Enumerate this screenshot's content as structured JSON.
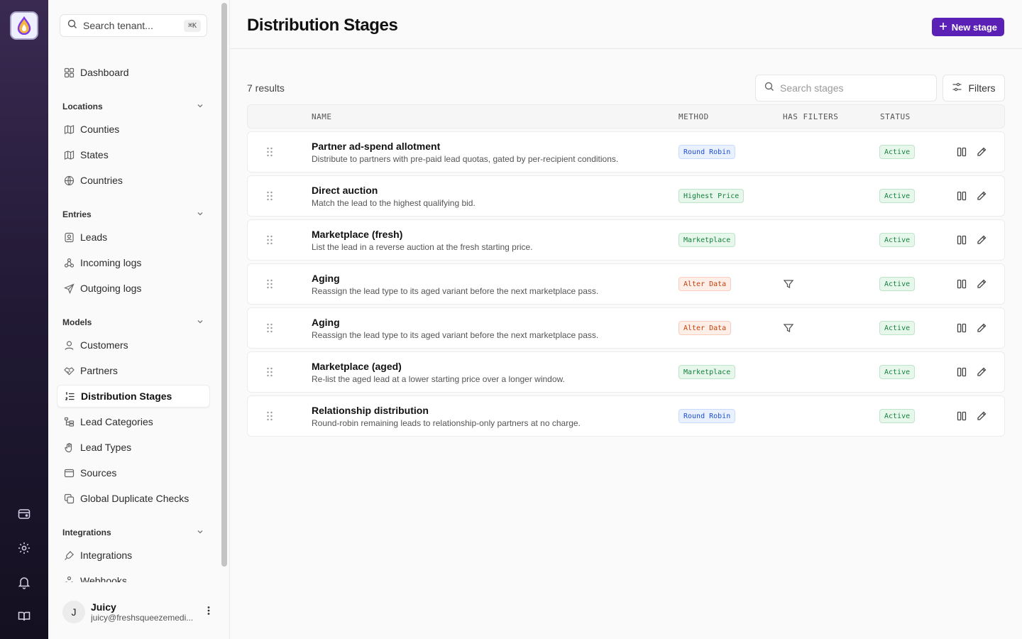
{
  "sidebar": {
    "search_placeholder": "Search tenant...",
    "search_shortcut": "⌘K",
    "dashboard": "Dashboard",
    "sections": {
      "locations": "Locations",
      "entries": "Entries",
      "models": "Models",
      "integrations": "Integrations"
    },
    "items": {
      "counties": "Counties",
      "states": "States",
      "countries": "Countries",
      "leads": "Leads",
      "incoming_logs": "Incoming logs",
      "outgoing_logs": "Outgoing logs",
      "customers": "Customers",
      "partners": "Partners",
      "distribution_stages": "Distribution Stages",
      "lead_categories": "Lead Categories",
      "lead_types": "Lead Types",
      "sources": "Sources",
      "global_duplicate_checks": "Global Duplicate Checks",
      "integrations": "Integrations",
      "webhooks": "Webhooks"
    },
    "user": {
      "initial": "J",
      "name": "Juicy",
      "email": "juicy@freshsqueezemedi..."
    }
  },
  "page": {
    "title": "Distribution Stages",
    "new_button": "New stage",
    "results": "7 results",
    "search_placeholder": "Search stages",
    "filters_label": "Filters"
  },
  "table": {
    "columns": [
      "NAME",
      "METHOD",
      "HAS FILTERS",
      "STATUS"
    ],
    "rows": [
      {
        "name": "Partner ad-spend allotment",
        "desc": "Distribute to partners with pre-paid lead quotas, gated by per-recipient conditions.",
        "method": "Round Robin",
        "method_color": "blue",
        "has_filters": false,
        "status": "Active"
      },
      {
        "name": "Direct auction",
        "desc": "Match the lead to the highest qualifying bid.",
        "method": "Highest Price",
        "method_color": "green",
        "has_filters": false,
        "status": "Active"
      },
      {
        "name": "Marketplace (fresh)",
        "desc": "List the lead in a reverse auction at the fresh starting price.",
        "method": "Marketplace",
        "method_color": "green",
        "has_filters": false,
        "status": "Active"
      },
      {
        "name": "Aging",
        "desc": "Reassign the lead type to its aged variant before the next marketplace pass.",
        "method": "Alter Data",
        "method_color": "orange",
        "has_filters": true,
        "status": "Active"
      },
      {
        "name": "Aging",
        "desc": "Reassign the lead type to its aged variant before the next marketplace pass.",
        "method": "Alter Data",
        "method_color": "orange",
        "has_filters": true,
        "status": "Active"
      },
      {
        "name": "Marketplace (aged)",
        "desc": "Re-list the aged lead at a lower starting price over a longer window.",
        "method": "Marketplace",
        "method_color": "green",
        "has_filters": false,
        "status": "Active"
      },
      {
        "name": "Relationship distribution",
        "desc": "Round-robin remaining leads to relationship-only partners at no charge.",
        "method": "Round Robin",
        "method_color": "blue",
        "has_filters": false,
        "status": "Active"
      }
    ]
  },
  "colors": {
    "accent": "#5b21b6",
    "rail_top": "#3a2a52",
    "rail_bottom": "#141020"
  }
}
